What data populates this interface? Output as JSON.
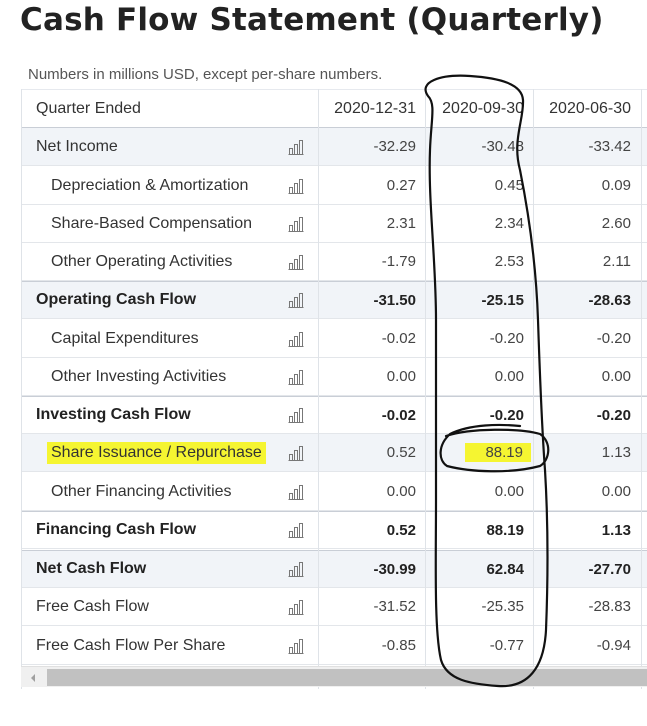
{
  "page": {
    "title": "Cash Flow Statement (Quarterly)",
    "subtitle": "Numbers in millions USD, except per-share numbers."
  },
  "table": {
    "header_label": "Quarter Ended",
    "columns": [
      "2020-12-31",
      "2020-09-30",
      "2020-06-30"
    ],
    "rows": [
      {
        "label": "Net Income",
        "values": [
          "-32.29",
          "-30.48",
          "-33.42"
        ]
      },
      {
        "label": "Depreciation & Amortization",
        "values": [
          "0.27",
          "0.45",
          "0.09"
        ]
      },
      {
        "label": "Share-Based Compensation",
        "values": [
          "2.31",
          "2.34",
          "2.60"
        ]
      },
      {
        "label": "Other Operating Activities",
        "values": [
          "-1.79",
          "2.53",
          "2.11"
        ]
      },
      {
        "label": "Operating Cash Flow",
        "values": [
          "-31.50",
          "-25.15",
          "-28.63"
        ]
      },
      {
        "label": "Capital Expenditures",
        "values": [
          "-0.02",
          "-0.20",
          "-0.20"
        ]
      },
      {
        "label": "Other Investing Activities",
        "values": [
          "0.00",
          "0.00",
          "0.00"
        ]
      },
      {
        "label": "Investing Cash Flow",
        "values": [
          "-0.02",
          "-0.20",
          "-0.20"
        ]
      },
      {
        "label": "Share Issuance / Repurchase",
        "values": [
          "0.52",
          "88.19",
          "1.13"
        ]
      },
      {
        "label": "Other Financing Activities",
        "values": [
          "0.00",
          "0.00",
          "0.00"
        ]
      },
      {
        "label": "Financing Cash Flow",
        "values": [
          "0.52",
          "88.19",
          "1.13"
        ]
      },
      {
        "label": "Net Cash Flow",
        "values": [
          "-30.99",
          "62.84",
          "-27.70"
        ]
      },
      {
        "label": "Free Cash Flow",
        "values": [
          "-31.52",
          "-25.35",
          "-28.83"
        ]
      },
      {
        "label": "Free Cash Flow Per Share",
        "values": [
          "-0.85",
          "-0.77",
          "-0.94"
        ]
      }
    ]
  },
  "icons": {
    "row_chart": "bar-chart-icon",
    "scroll_left": "chevron-left-icon"
  },
  "colors": {
    "highlight": "#f5f531",
    "zebra": "#f1f4f8",
    "ink": "#000000"
  }
}
